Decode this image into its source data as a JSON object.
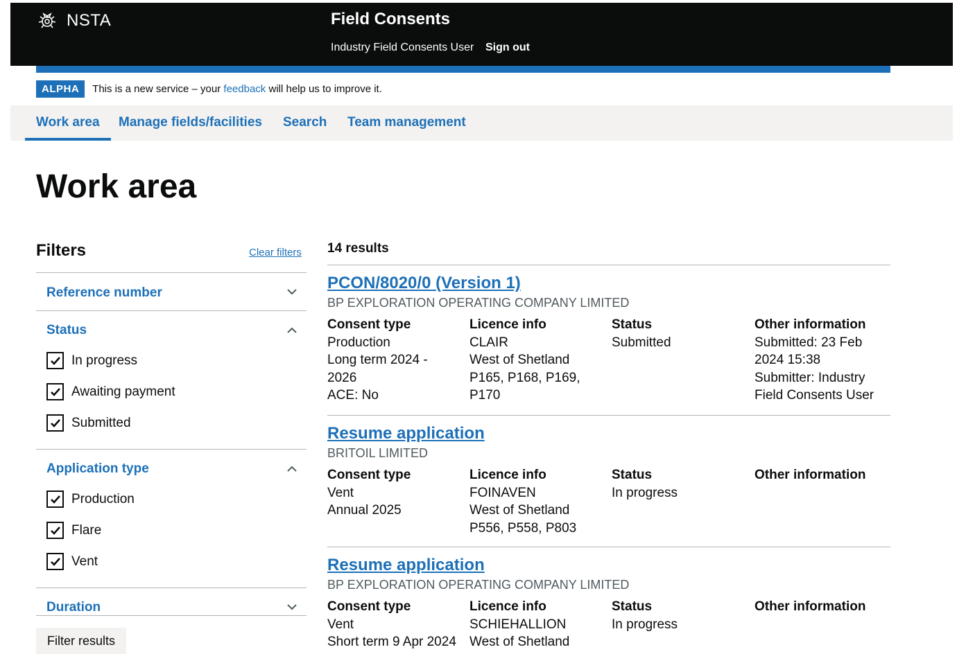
{
  "header": {
    "logo_text": "NSTA",
    "service_name": "Field Consents",
    "user_name": "Industry Field Consents User",
    "sign_out": "Sign out"
  },
  "phase_banner": {
    "tag": "ALPHA",
    "text_before": "This is a new service – your ",
    "link": "feedback",
    "text_after": " will help us to improve it."
  },
  "nav": {
    "items": [
      "Work area",
      "Manage fields/facilities",
      "Search",
      "Team management"
    ],
    "active": "Work area"
  },
  "page_title": "Work area",
  "filters": {
    "heading": "Filters",
    "clear": "Clear filters",
    "sections": [
      {
        "title": "Reference number",
        "expanded": false,
        "options": []
      },
      {
        "title": "Status",
        "expanded": true,
        "options": [
          {
            "label": "In progress",
            "checked": true
          },
          {
            "label": "Awaiting payment",
            "checked": true
          },
          {
            "label": "Submitted",
            "checked": true
          }
        ]
      },
      {
        "title": "Application type",
        "expanded": true,
        "options": [
          {
            "label": "Production",
            "checked": true
          },
          {
            "label": "Flare",
            "checked": true
          },
          {
            "label": "Vent",
            "checked": true
          }
        ]
      },
      {
        "title": "Duration",
        "expanded": false,
        "options": []
      }
    ],
    "button": "Filter results"
  },
  "results": {
    "count": "14 results",
    "column_headers": [
      "Consent type",
      "Licence info",
      "Status",
      "Other information"
    ],
    "items": [
      {
        "title": "PCON/8020/0 (Version 1)",
        "organisation": "BP EXPLORATION OPERATING COMPANY LIMITED",
        "consent_type": [
          "Production",
          "Long term 2024 -",
          "2026",
          "ACE: No"
        ],
        "licence_info": [
          "CLAIR",
          "West of Shetland",
          "P165, P168, P169,",
          "P170"
        ],
        "status": [
          "Submitted"
        ],
        "other_info": [
          "Submitted: 23 Feb",
          "2024 15:38",
          "Submitter: Industry",
          "Field Consents User"
        ]
      },
      {
        "title": "Resume application",
        "organisation": "BRITOIL LIMITED",
        "consent_type": [
          "Vent",
          "Annual 2025"
        ],
        "licence_info": [
          "FOINAVEN",
          "West of Shetland",
          "P556, P558, P803"
        ],
        "status": [
          "In progress"
        ],
        "other_info": []
      },
      {
        "title": "Resume application",
        "organisation": "BP EXPLORATION OPERATING COMPANY LIMITED",
        "consent_type": [
          "Vent",
          "Short term 9 Apr 2024"
        ],
        "licence_info": [
          "SCHIEHALLION",
          "West of Shetland"
        ],
        "status": [
          "In progress"
        ],
        "other_info": []
      }
    ]
  },
  "colors": {
    "header_bg": "#0b0c0c",
    "link_blue": "#1d70b8",
    "nav_bg": "#f3f2f1",
    "border": "#b1b4b6",
    "secondary_text": "#505a5f"
  }
}
